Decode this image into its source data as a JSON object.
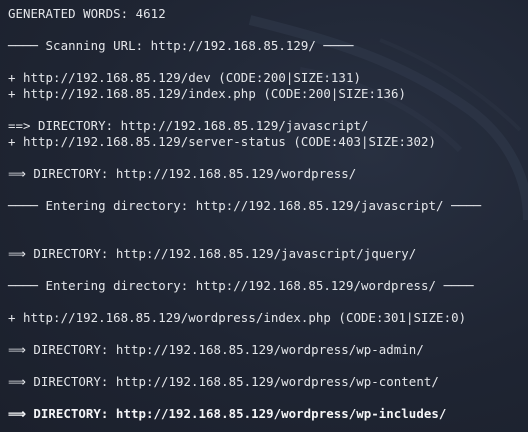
{
  "terminal": {
    "lines": {
      "generated_words": "GENERATED WORDS: 4612",
      "scanning_url": "──── Scanning URL: http://192.168.85.129/ ────",
      "found_dev": "+ http://192.168.85.129/dev (CODE:200|SIZE:131)",
      "found_index": "+ http://192.168.85.129/index.php (CODE:200|SIZE:136)",
      "dir_javascript": "==> DIRECTORY: http://192.168.85.129/javascript/",
      "found_server_status": "+ http://192.168.85.129/server-status (CODE:403|SIZE:302)",
      "dir_wordpress": "⟹ DIRECTORY: http://192.168.85.129/wordpress/",
      "entering_javascript": "──── Entering directory: http://192.168.85.129/javascript/ ────",
      "dir_jquery": "⟹ DIRECTORY: http://192.168.85.129/javascript/jquery/",
      "entering_wordpress": "──── Entering directory: http://192.168.85.129/wordpress/ ────",
      "found_wp_index": "+ http://192.168.85.129/wordpress/index.php (CODE:301|SIZE:0)",
      "dir_wp_admin": "⟹ DIRECTORY: http://192.168.85.129/wordpress/wp-admin/",
      "dir_wp_content": "⟹ DIRECTORY: http://192.168.85.129/wordpress/wp-content/",
      "dir_wp_includes": "⟹ DIRECTORY: http://192.168.85.129/wordpress/wp-includes/"
    }
  }
}
